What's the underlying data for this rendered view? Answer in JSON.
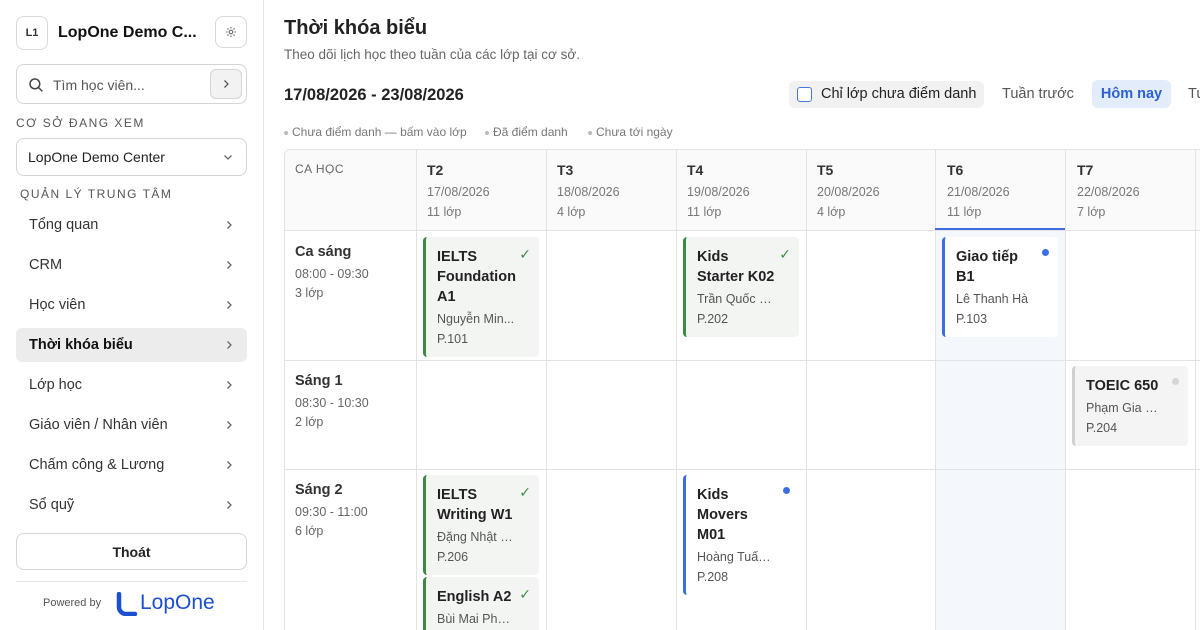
{
  "sidebar": {
    "logo_text": "L1",
    "center_name": "LopOne Demo C...",
    "search_placeholder": "Tìm học viên...",
    "section_viewing": "CƠ SỞ ĐANG XEM",
    "selected_center": "LopOne Demo Center",
    "section_manage": "QUẢN LÝ TRUNG TÂM",
    "nav_items": [
      {
        "label": "Tổng quan",
        "active": false
      },
      {
        "label": "CRM",
        "active": false
      },
      {
        "label": "Học viên",
        "active": false
      },
      {
        "label": "Thời khóa biểu",
        "active": true
      },
      {
        "label": "Lớp học",
        "active": false
      },
      {
        "label": "Giáo viên / Nhân viên",
        "active": false
      },
      {
        "label": "Chấm công & Lương",
        "active": false
      },
      {
        "label": "Sổ quỹ",
        "active": false
      }
    ],
    "logout_label": "Thoát",
    "powered_by": "Powered by",
    "powered_brand": "LopOne"
  },
  "header": {
    "title": "Thời khóa biểu",
    "subtitle": "Theo dõi lịch học theo tuần của các lớp tại cơ sở.",
    "date_range": "17/08/2026 - 23/08/2026",
    "filter_label": "Chỉ lớp chưa điểm danh",
    "filter_checked": false,
    "prev_week": "Tuần trước",
    "today": "Hôm nay",
    "next_week": "Tu"
  },
  "legend": [
    "Chưa điểm danh — bấm vào lớp",
    "Đã điểm danh",
    "Chưa tới ngày"
  ],
  "schedule": {
    "slot_header": "CA HỌC",
    "days": [
      {
        "code": "T2",
        "date": "17/08/2026",
        "count": "11 lớp"
      },
      {
        "code": "T3",
        "date": "18/08/2026",
        "count": "4 lớp"
      },
      {
        "code": "T4",
        "date": "19/08/2026",
        "count": "11 lớp"
      },
      {
        "code": "T5",
        "date": "20/08/2026",
        "count": "4 lớp"
      },
      {
        "code": "T6",
        "date": "21/08/2026",
        "count": "11 lớp",
        "today": true
      },
      {
        "code": "T7",
        "date": "22/08/2026",
        "count": "7 lớp"
      }
    ],
    "slots": [
      {
        "name": "Ca sáng",
        "time": "08:00 - 09:30",
        "count": "3 lớp"
      },
      {
        "name": "Sáng 1",
        "time": "08:30 - 10:30",
        "count": "2 lớp"
      },
      {
        "name": "Sáng 2",
        "time": "09:30 - 11:00",
        "count": "6 lớp"
      }
    ],
    "classes": [
      {
        "title": "IELTS Foundation A1",
        "teacher": "Nguyễn Min...",
        "room": "P.101",
        "status": "done"
      },
      {
        "title": "Kids Starter K02",
        "teacher": "Trần Quốc B...",
        "room": "P.202",
        "status": "done"
      },
      {
        "title": "Giao tiếp B1",
        "teacher": "Lê Thanh Hà",
        "room": "P.103",
        "status": "pending"
      },
      {
        "title": "TOEIC 650",
        "teacher": "Phạm Gia Huy",
        "room": "P.204",
        "status": "future"
      },
      {
        "title": "IELTS Writing W1",
        "teacher": "Đặng Nhật N...",
        "room": "P.206",
        "status": "done"
      },
      {
        "title": "Kids Movers M01",
        "teacher": "Hoàng Tuấn ...",
        "room": "P.208",
        "status": "pending"
      },
      {
        "title": "English A2",
        "teacher": "Bùi Mai Phư...",
        "room": "",
        "status": "done"
      }
    ]
  },
  "colors": {
    "accent": "#3b6fe0",
    "done": "#3d8a46",
    "future": "#d0d0d0"
  }
}
